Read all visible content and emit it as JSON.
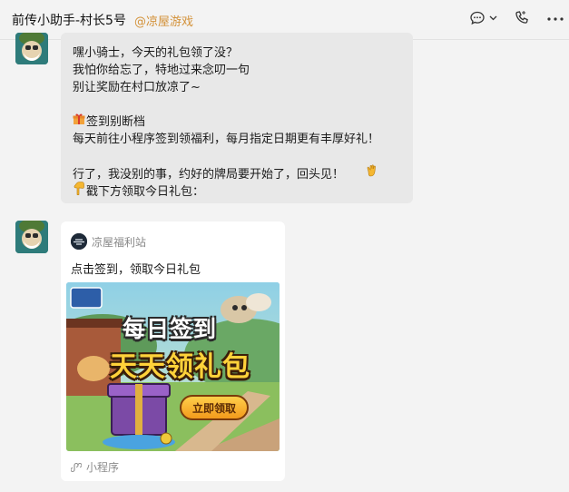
{
  "header": {
    "title": "前传小助手-村长5号",
    "channel": "@凉屋游戏",
    "icons": [
      "chat-icon",
      "chevron-down-icon",
      "phone-icon",
      "more-icon"
    ]
  },
  "message1": {
    "lines": [
      "嘿小骑士，今天的礼包领了没？",
      "我怕你给忘了，特地过来念叨一句",
      "别让奖励在村口放凉了~",
      "签到别断档",
      "每天前往小程序签到领福利，每月指定日期更有丰厚好礼！",
      "行了，我没别的事，约好的牌局要开始了，回头见！",
      "戳下方领取今日礼包："
    ]
  },
  "message2": {
    "card": {
      "source": "凉屋福利站",
      "title": "点击签到，领取今日礼包",
      "banner_line1": "每日签到",
      "banner_line2": "天天领礼包",
      "banner_button": "立即领取",
      "banner_logo": "元气骑士前传",
      "footer": "小程序"
    }
  },
  "colors": {
    "channel": "#d3923a",
    "bubble": "#e8e8e8",
    "background": "#f3f3f3"
  }
}
